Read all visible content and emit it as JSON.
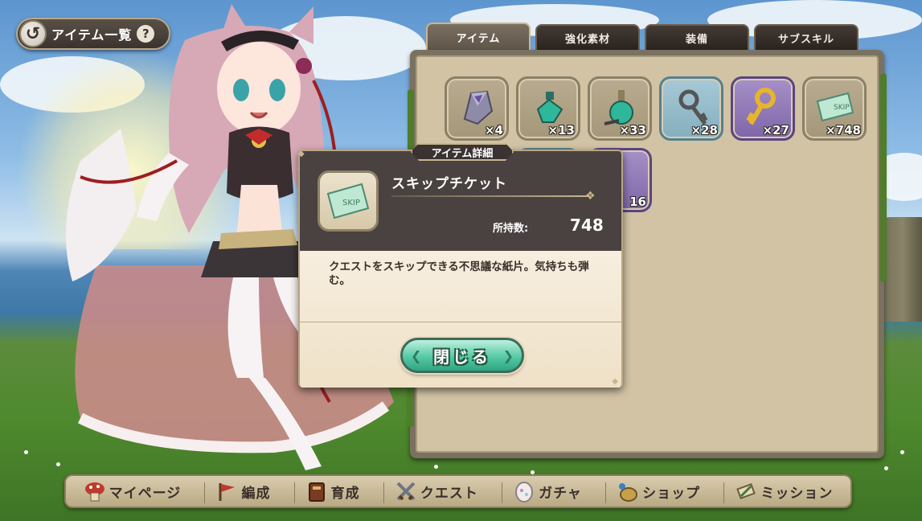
{
  "header": {
    "back_label": "アイテム一覧",
    "help_glyph": "?"
  },
  "tabs": [
    {
      "label": "アイテム",
      "active": true
    },
    {
      "label": "強化素材",
      "active": false
    },
    {
      "label": "装備",
      "active": false
    },
    {
      "label": "サブスキル",
      "active": false
    }
  ],
  "items": [
    {
      "icon": "crystal-icon",
      "count": "×4",
      "rarity": "normal"
    },
    {
      "icon": "potion-bottle-icon",
      "count": "×13",
      "rarity": "normal"
    },
    {
      "icon": "potion-flask-icon",
      "count": "×33",
      "rarity": "normal"
    },
    {
      "icon": "silver-key-icon",
      "count": "×28",
      "rarity": "blue"
    },
    {
      "icon": "gold-key-icon",
      "count": "×27",
      "rarity": "purple"
    },
    {
      "icon": "skip-ticket-icon",
      "count": "×748",
      "rarity": "normal"
    }
  ],
  "hidden_item_partial_count": "16",
  "modal": {
    "title": "アイテム詳細",
    "item_name": "スキップチケット",
    "owned_label": "所持数:",
    "owned_value": "748",
    "description": "クエストをスキップできる不思議な紙片。気持ちも弾む。",
    "close_label": "閉じる"
  },
  "bottom_nav": [
    {
      "label": "マイページ",
      "icon": "mushroom-house-icon"
    },
    {
      "label": "編成",
      "icon": "flag-icon"
    },
    {
      "label": "育成",
      "icon": "book-icon"
    },
    {
      "label": "クエスト",
      "icon": "crossed-swords-icon"
    },
    {
      "label": "ガチャ",
      "icon": "egg-icon"
    },
    {
      "label": "ショップ",
      "icon": "coin-bag-icon"
    },
    {
      "label": "ミッション",
      "icon": "scroll-icon"
    }
  ],
  "colors": {
    "panel_bg": "#d2c3a4",
    "modal_header_bg": "#4a4240",
    "close_button": "#55c9a3",
    "rarity_blue": "#85aebe",
    "rarity_purple": "#7e66a7"
  }
}
